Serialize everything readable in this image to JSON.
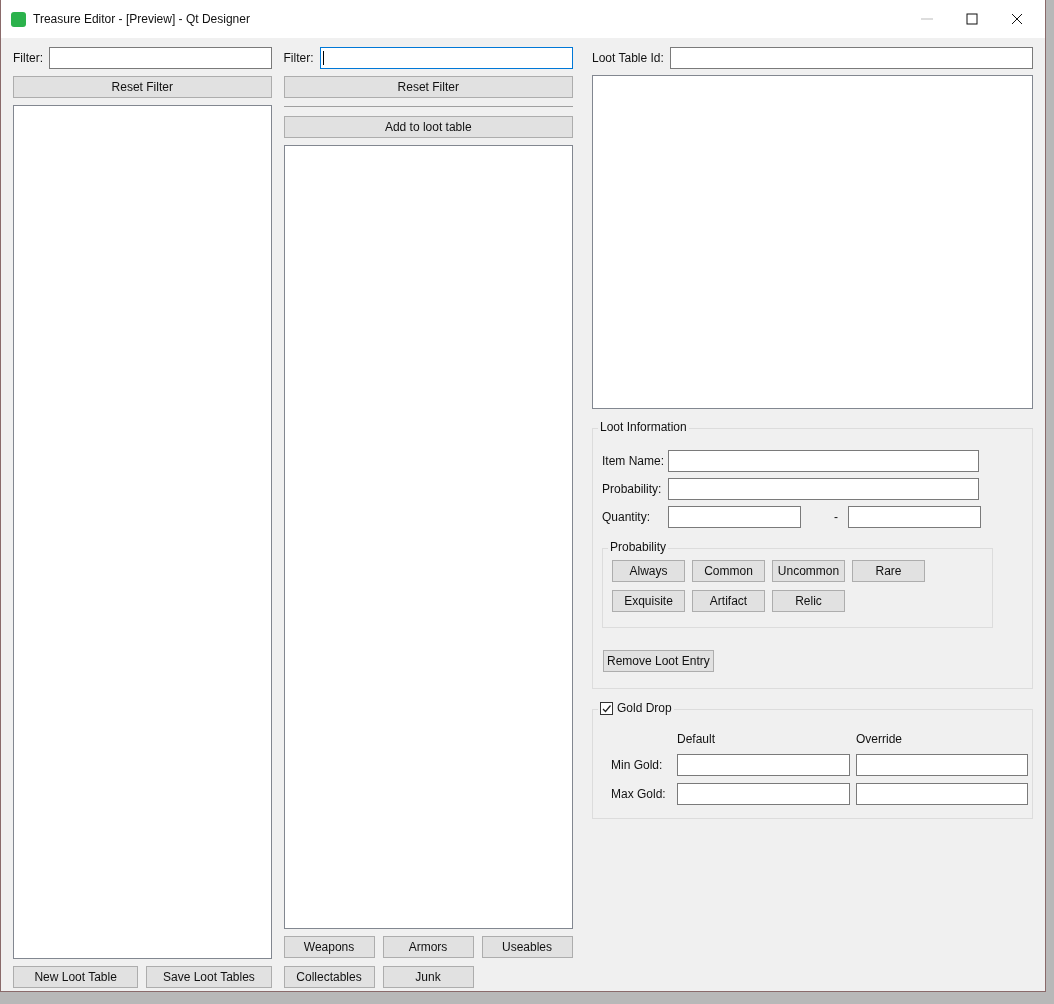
{
  "window": {
    "title": "Treasure Editor - [Preview] - Qt Designer"
  },
  "left_panel": {
    "filter": {
      "label": "Filter:",
      "focused": false
    },
    "reset_button": "Reset Filter",
    "buttons": [
      "New Loot Table",
      "Save Loot Tables"
    ]
  },
  "middle_panel": {
    "filter": {
      "label": "Filter:",
      "focused": true
    },
    "reset_button": "Reset Filter",
    "add_button": "Add to loot table",
    "category_buttons": [
      "Weapons",
      "Armors",
      "Useables",
      "Collectables",
      "Junk"
    ]
  },
  "right_panel": {
    "loot_table_id": {
      "label": "Loot Table Id:"
    },
    "loot_information": {
      "title": "Loot Information",
      "fields": [
        "Item Name:",
        "Probability:"
      ],
      "quantity": {
        "label": "Quantity:",
        "separator": "-"
      },
      "probability_group": {
        "title": "Probability",
        "buttons": [
          "Always",
          "Common",
          "Uncommon",
          "Rare",
          "Exquisite",
          "Artifact",
          "Relic"
        ]
      },
      "remove_button": "Remove Loot Entry"
    },
    "gold_drop": {
      "title": "Gold Drop",
      "checked": true,
      "columns": [
        "Default",
        "Override"
      ],
      "rows": [
        "Min Gold:",
        "Max Gold:"
      ]
    }
  }
}
